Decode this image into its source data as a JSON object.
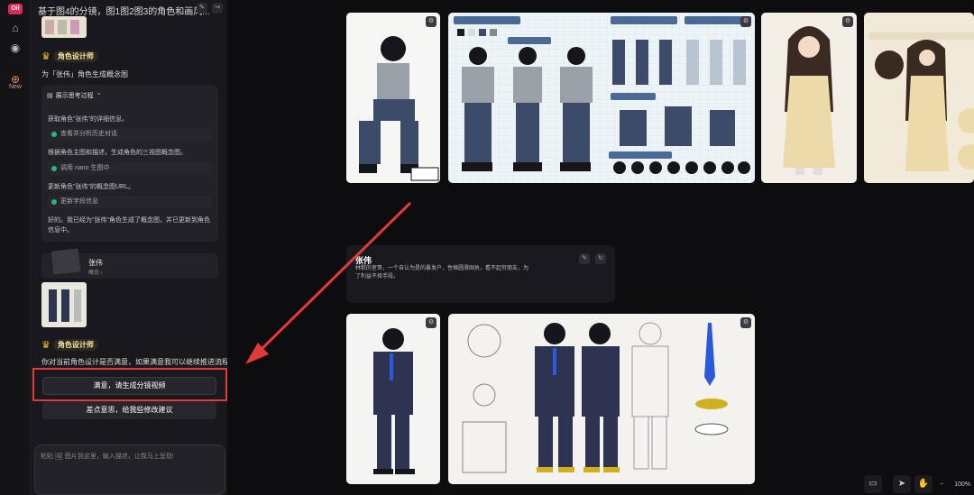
{
  "rail": {
    "new_label": "New"
  },
  "panel": {
    "title": "基于图4的分镜，图1图2图3的角色和画风...",
    "agent_name": "角色设计师",
    "msg1": "为「张伟」角色生成概念图",
    "thinking": {
      "header": "展示思考过程",
      "line1": "获取角色\"张伟\"的详细信息。",
      "step1": "查看并分析历史对话",
      "line2": "根据角色主图和描述，生成角色的三视图概念图。",
      "step2": "调用 nano 生图中",
      "line3": "更新角色\"张伟\"的概念图URL。",
      "step3": "更新字段信息",
      "line4": "好的。我已经为\"张伟\"角色生成了概念图，并已更新到角色",
      "line5": "信息中。"
    },
    "card": {
      "name": "张伟",
      "sub": "概念 ›"
    },
    "agent_name2": "角色设计师",
    "msg2": "你对当前角色设计是否满意，如果满意我可以继续推进流程",
    "btn_ok": "满意，请生成分镜视频",
    "btn_fix": "差点意思，给我些修改建议",
    "input_placeholder": "粘贴 🖼 图片到这里，输入描述，让我马上呈现!"
  },
  "canvas": {
    "info_name": "张伟",
    "info_desc": "林默的室哥，一个自认为是的暴发户，性格圆滑固执，看不起穷朋友，为了利益不择手段。",
    "sheet_labels": {
      "palette": "COLOR PALETTE & ACCESSORIES",
      "outfit4": "OUTFIT DESIGN 4",
      "outfit5": "OUTFIT DESIGN 5",
      "view": "CHARACTER VIEW",
      "action": "ACTION POSES",
      "expression": "EXPRESSION SHEET",
      "ref": "CHARACTER REFERENCE SHEET",
      "hair": "LONG DARK HAIR"
    },
    "zoom": "100%"
  }
}
